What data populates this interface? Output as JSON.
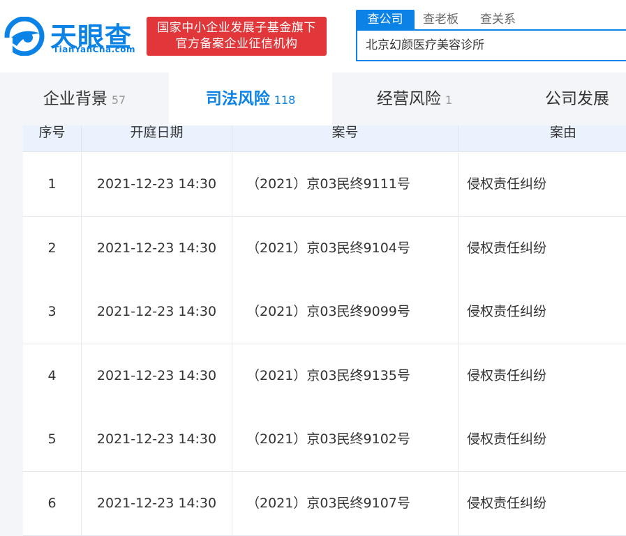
{
  "brand": {
    "name_cn": "天眼查",
    "name_en": "TianYanCha.com",
    "badge_line1": "国家中小企业发展子基金旗下",
    "badge_line2": "官方备案企业征信机构"
  },
  "search": {
    "tabs": [
      "查公司",
      "查老板",
      "查关系"
    ],
    "active_tab": "查公司",
    "query": "北京幻颜医疗美容诊所"
  },
  "nav": {
    "tabs": [
      {
        "label": "企业背景",
        "count": "57"
      },
      {
        "label": "司法风险",
        "count": "118"
      },
      {
        "label": "经营风险",
        "count": "1"
      },
      {
        "label": "公司发展",
        "count": ""
      }
    ],
    "active": "司法风险"
  },
  "table": {
    "headers": [
      "序号",
      "开庭日期",
      "案号",
      "案由"
    ],
    "rows": [
      [
        "1",
        "2021-12-23 14:30",
        "（2021）京03民终9111号",
        "侵权责任纠纷"
      ],
      [
        "2",
        "2021-12-23 14:30",
        "（2021）京03民终9104号",
        "侵权责任纠纷"
      ],
      [
        "3",
        "2021-12-23 14:30",
        "（2021）京03民终9099号",
        "侵权责任纠纷"
      ],
      [
        "4",
        "2021-12-23 14:30",
        "（2021）京03民终9135号",
        "侵权责任纠纷"
      ],
      [
        "5",
        "2021-12-23 14:30",
        "（2021）京03民终9102号",
        "侵权责任纠纷"
      ],
      [
        "6",
        "2021-12-23 14:30",
        "（2021）京03民终9107号",
        "侵权责任纠纷"
      ]
    ]
  },
  "colors": {
    "brand_blue": "#0b82e6",
    "badge_red": "#e2373a",
    "header_bg": "#eaf3fd"
  }
}
